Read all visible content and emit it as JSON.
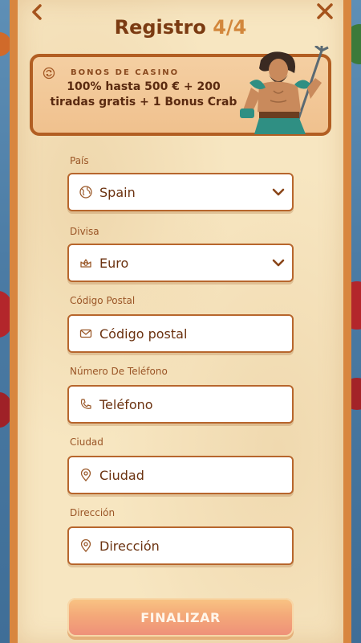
{
  "header": {
    "title": "Registro",
    "step": "4/4"
  },
  "bonus": {
    "label": "BONOS DE CASINO",
    "text": "100% hasta 500 € + 200 tiradas gratis + 1 Bonus Crab"
  },
  "form": {
    "country": {
      "label": "País",
      "value": "Spain",
      "icon": "globe-icon"
    },
    "currency": {
      "label": "Divisa",
      "value": "Euro",
      "icon": "crown-icon"
    },
    "postal": {
      "label": "Código Postal",
      "placeholder": "Código postal",
      "icon": "envelope-icon"
    },
    "phone": {
      "label": "Número De Teléfono",
      "placeholder": "Teléfono",
      "icon": "phone-icon"
    },
    "city": {
      "label": "Ciudad",
      "placeholder": "Ciudad",
      "icon": "location-pin-icon"
    },
    "address": {
      "label": "Dirección",
      "placeholder": "Dirección",
      "icon": "location-pin-icon"
    }
  },
  "finalize_label": "FINALIZAR",
  "colors": {
    "accent": "#d8863f",
    "title": "#7b3b12",
    "parchment": "#f7e6c1"
  }
}
